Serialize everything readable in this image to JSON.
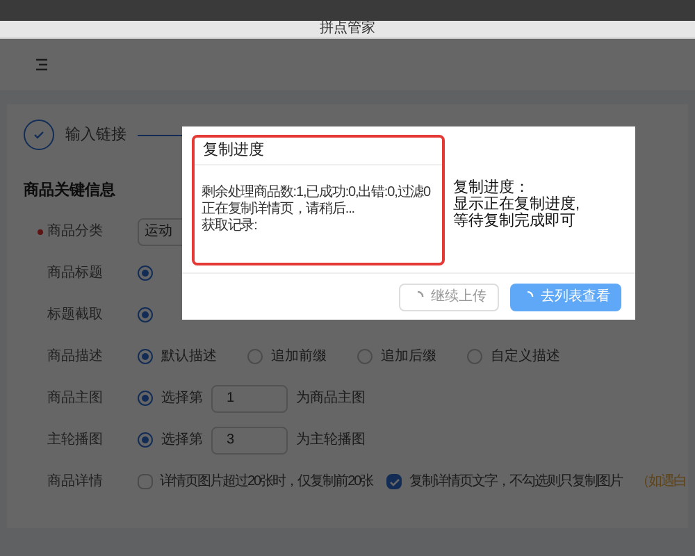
{
  "window": {
    "title": "拼点管家"
  },
  "steps": [
    {
      "label": "输入链接"
    }
  ],
  "section_title": "商品关键信息",
  "form": [
    {
      "kind": "select",
      "label": "商品分类",
      "required": true,
      "value": "运动"
    },
    {
      "kind": "radio",
      "label": "商品标题",
      "required": false,
      "options": [
        {
          "selected": true
        }
      ]
    },
    {
      "kind": "radio",
      "label": "标题截取",
      "required": false,
      "options": [
        {
          "selected": true
        }
      ]
    },
    {
      "kind": "radio",
      "label": "商品描述",
      "required": false,
      "options": [
        {
          "label": "默认描述",
          "selected": true
        },
        {
          "label": "追加前缀",
          "selected": false
        },
        {
          "label": "追加后缀",
          "selected": false
        },
        {
          "label": "自定义描述",
          "selected": false
        }
      ]
    },
    {
      "kind": "number",
      "label": "商品主图",
      "required": false,
      "selected": true,
      "prefix": "选择第",
      "value": "1",
      "suffix": "为商品主图"
    },
    {
      "kind": "number",
      "label": "主轮播图",
      "required": false,
      "selected": true,
      "prefix": "选择第",
      "value": "3",
      "suffix": "为主轮播图"
    },
    {
      "kind": "checks",
      "label": "商品详情",
      "required": false,
      "options": [
        {
          "label": "详情页图片超过20张时，仅复制前20张",
          "checked": false
        },
        {
          "label": "复制详情页文字，不勾选则只复制图片",
          "checked": true
        }
      ],
      "note": "（如遇白"
    }
  ],
  "dialog": {
    "title": "复制进度",
    "lines": [
      "剩余处理商品数:1,已成功:0,出错:0,过滤0",
      "正在复制详情页，请稍后...",
      "获取记录:"
    ],
    "buttons": [
      {
        "label": "继续上传",
        "primary": false,
        "loading": true
      },
      {
        "label": "去列表查看",
        "primary": true,
        "loading": true
      }
    ]
  },
  "annotation": {
    "lines": [
      "复制进度：",
      "显示正在复制进度,",
      "等待复制完成即可"
    ]
  }
}
